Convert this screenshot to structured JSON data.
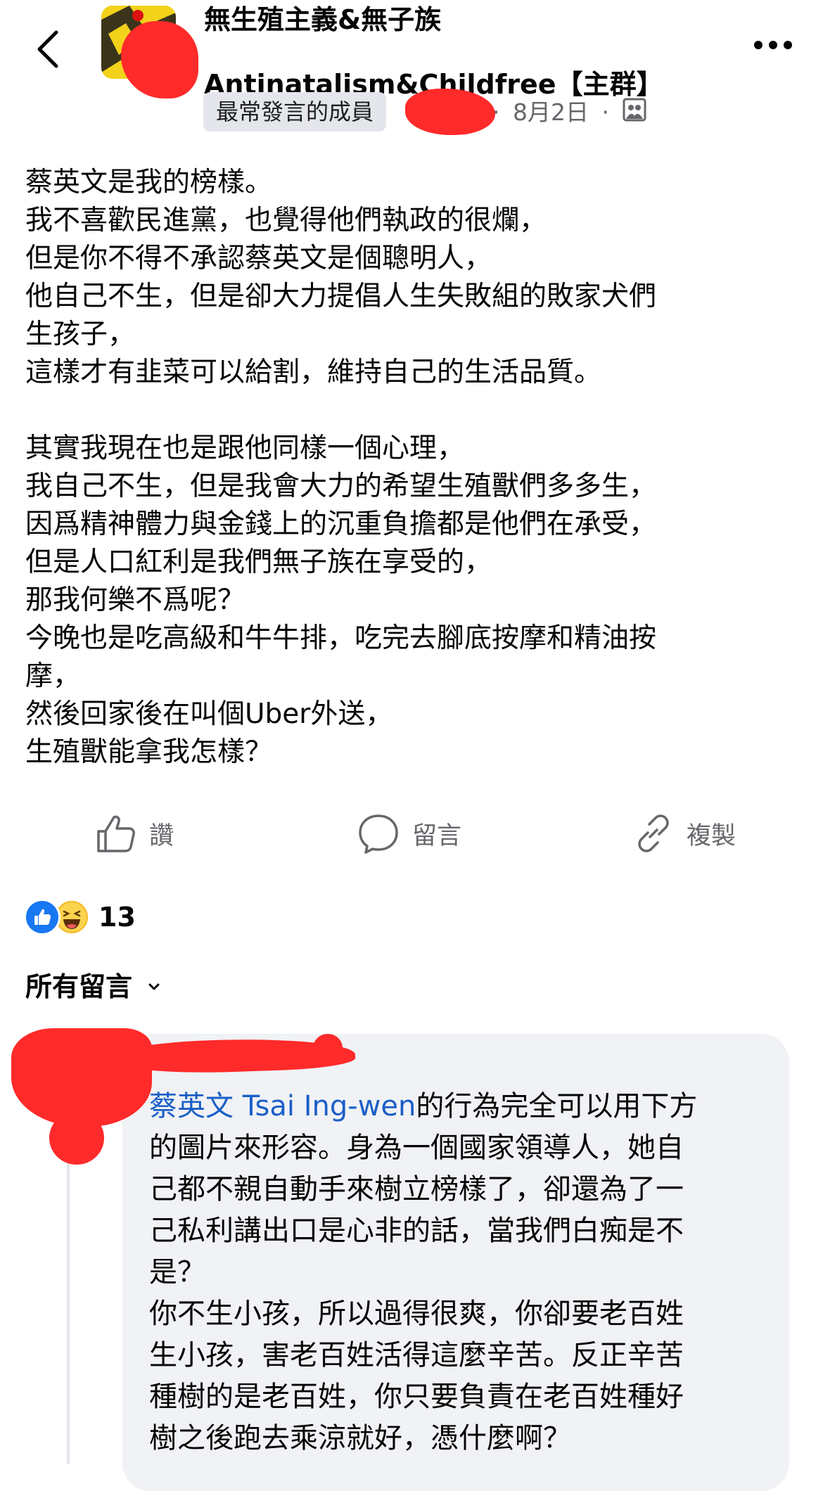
{
  "header": {
    "back_icon": "chevron-left-icon",
    "group_title_line1": "無生殖主義&無子族",
    "group_title_line2": "Antinatalism&Childfree【主群】",
    "more_icon": "more-horizontal-icon",
    "member_badge": "最常發言的成員",
    "separator": "·",
    "post_date": "8月2日",
    "privacy_icon": "group-privacy-icon"
  },
  "post": {
    "body": "蔡英文是我的榜樣。\n我不喜歡民進黨，也覺得他們執政的很爛，\n但是你不得不承認蔡英文是個聰明人，\n他自己不生，但是卻大力提倡人生失敗組的敗家犬們\n生孩子，\n這樣才有韭菜可以給割，維持自己的生活品質。\n\n其實我現在也是跟他同樣一個心理，\n我自己不生，但是我會大力的希望生殖獸們多多生，\n因爲精神體力與金錢上的沉重負擔都是他們在承受，\n但是人口紅利是我們無子族在享受的，\n那我何樂不爲呢？\n今晚也是吃高級和牛牛排，吃完去腳底按摩和精油按\n摩，\n然後回家後在叫個Uber外送，\n生殖獸能拿我怎樣？"
  },
  "actions": {
    "like_label": "讚",
    "comment_label": "留言",
    "copy_label": "複製"
  },
  "reactions": {
    "types": [
      "like-reaction-icon",
      "haha-reaction-icon"
    ],
    "count": "13"
  },
  "comments": {
    "header_label": "所有留言",
    "items": [
      {
        "mention": "蔡英文 Tsai Ing-wen",
        "text": "的行為完全可以用下方\n的圖片來形容。身為一個國家領導人，她自\n己都不親自動手來樹立榜樣了，卻還為了一\n己私利講出口是心非的話，當我們白痴是不\n是？\n你不生小孩，所以過得很爽，你卻要老百姓\n生小孩，害老百姓活得這麼辛苦。反正辛苦\n種樹的是老百姓，你只要負責在老百姓種好\n樹之後跑去乘涼就好，憑什麼啊？"
      }
    ]
  },
  "colors": {
    "text": "#050505",
    "secondary_text": "#65676b",
    "badge_bg": "#e4e6eb",
    "comment_bg": "#f0f2f5",
    "mention": "#1b5fc7",
    "like_blue": "#1877f2",
    "redaction": "#ff2a2a"
  }
}
